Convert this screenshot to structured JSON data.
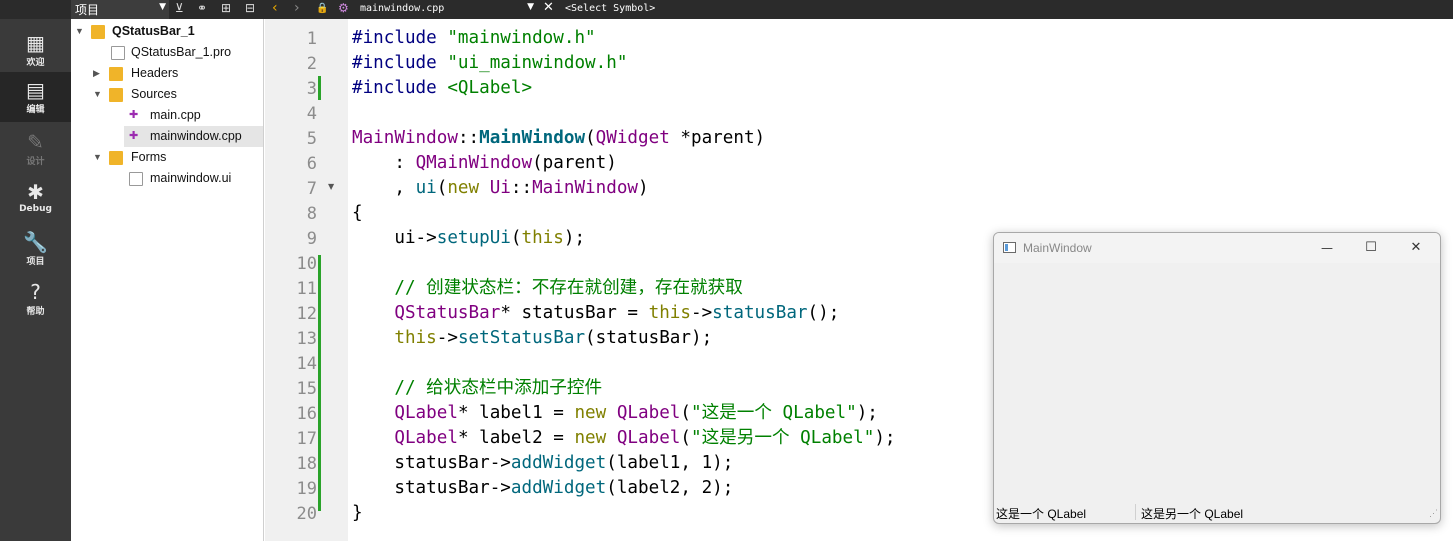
{
  "toolbar": {
    "project_selector": "项目",
    "nav_back": "‹",
    "nav_forward": "›",
    "open_file": "mainwindow.cpp",
    "symbol_selector": "<Select Symbol>"
  },
  "modes": [
    {
      "label": "欢迎",
      "icon": "grid-icon"
    },
    {
      "label": "编辑",
      "icon": "edit-document-icon",
      "active": true
    },
    {
      "label": "设计",
      "icon": "pencil-icon",
      "disabled": true
    },
    {
      "label": "Debug",
      "icon": "bug-icon"
    },
    {
      "label": "项目",
      "icon": "wrench-icon"
    },
    {
      "label": "帮助",
      "icon": "help-icon"
    }
  ],
  "tree": {
    "project": "QStatusBar_1",
    "pro_file": "QStatusBar_1.pro",
    "headers": "Headers",
    "sources": "Sources",
    "source_files": [
      "main.cpp",
      "mainwindow.cpp"
    ],
    "forms": "Forms",
    "form_files": [
      "mainwindow.ui"
    ],
    "selected": "mainwindow.cpp"
  },
  "editor": {
    "line_numbers": [
      "1",
      "2",
      "3",
      "4",
      "5",
      "6",
      "7",
      "8",
      "9",
      "10",
      "11",
      "12",
      "13",
      "14",
      "15",
      "16",
      "17",
      "18",
      "19",
      "20"
    ],
    "lines": [
      "#include \"mainwindow.h\"",
      "#include \"ui_mainwindow.h\"",
      "#include <QLabel>",
      "",
      "MainWindow::MainWindow(QWidget *parent)",
      "    : QMainWindow(parent)",
      "    , ui(new Ui::MainWindow)",
      "{",
      "    ui->setupUi(this);",
      "",
      "    // 创建状态栏：不存在就创建，存在就获取",
      "    QStatusBar* statusBar = this->statusBar();",
      "    this->setStatusBar(statusBar);",
      "",
      "    // 给状态栏中添加子控件",
      "    QLabel* label1 = new QLabel(\"这是一个 QLabel\");",
      "    QLabel* label2 = new QLabel(\"这是另一个 QLabel\");",
      "    statusBar->addWidget(label1, 1);",
      "    statusBar->addWidget(label2, 2);",
      "}"
    ]
  },
  "app_window": {
    "title": "MainWindow",
    "minimize": "—",
    "maximize": "☐",
    "close": "✕",
    "status_label1": "这是一个 QLabel",
    "status_label2": "这是另一个 QLabel"
  }
}
